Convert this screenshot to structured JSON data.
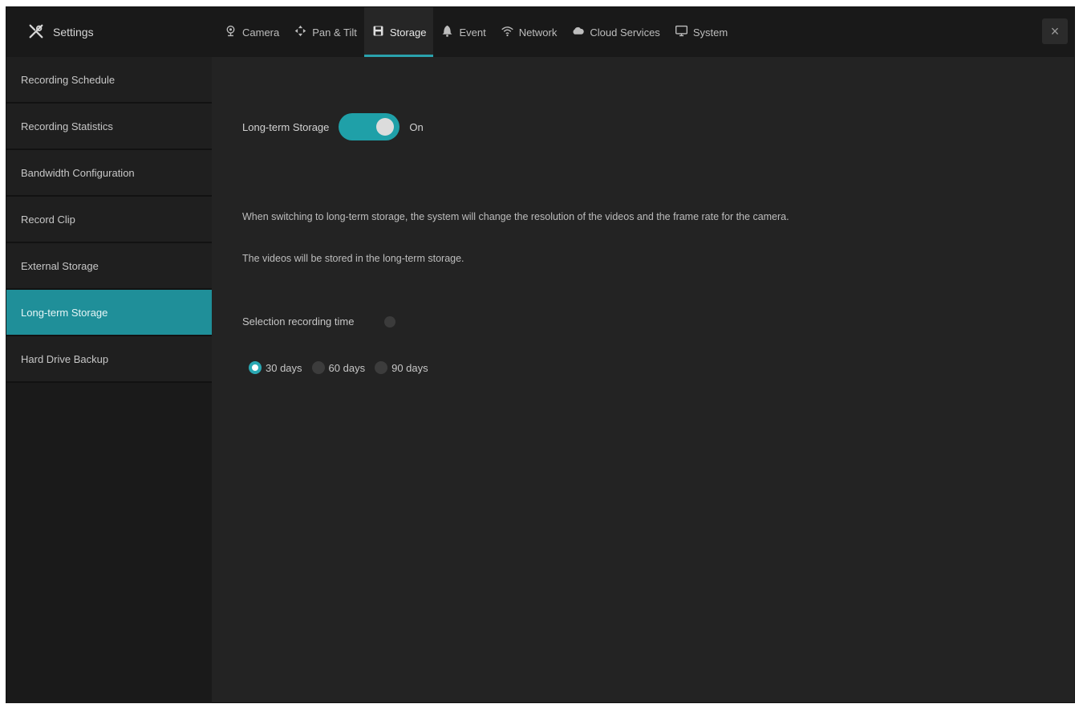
{
  "header": {
    "title": "Settings",
    "close_label": "×"
  },
  "tabs": [
    {
      "label": "Camera",
      "icon": "camera-icon"
    },
    {
      "label": "Pan & Tilt",
      "icon": "pan-tilt-icon"
    },
    {
      "label": "Storage",
      "icon": "storage-icon",
      "active": true
    },
    {
      "label": "Event",
      "icon": "bell-icon"
    },
    {
      "label": "Network",
      "icon": "wifi-icon"
    },
    {
      "label": "Cloud Services",
      "icon": "cloud-icon"
    },
    {
      "label": "System",
      "icon": "monitor-icon"
    }
  ],
  "sidebar": {
    "items": [
      {
        "label": "Recording Schedule"
      },
      {
        "label": "Recording Statistics"
      },
      {
        "label": "Bandwidth Configuration"
      },
      {
        "label": "Record Clip"
      },
      {
        "label": "External Storage"
      },
      {
        "label": "Long-term Storage",
        "active": true
      },
      {
        "label": "Hard Drive Backup"
      }
    ]
  },
  "content": {
    "toggle_label": "Long-term Storage",
    "toggle_state": "On",
    "description_1": "When switching to long-term storage, the system will change the resolution of the videos and the frame rate for the camera.",
    "description_2": "The videos will be stored in the long-term storage.",
    "period_label": "Selection recording time",
    "options": [
      {
        "label": "30 days",
        "selected": true
      },
      {
        "label": "60 days",
        "selected": false
      },
      {
        "label": "90 days",
        "selected": false
      }
    ]
  },
  "colors": {
    "accent": "#1fa0a8",
    "window_bg": "#232323",
    "sidebar_bg": "#1a1a1a"
  }
}
